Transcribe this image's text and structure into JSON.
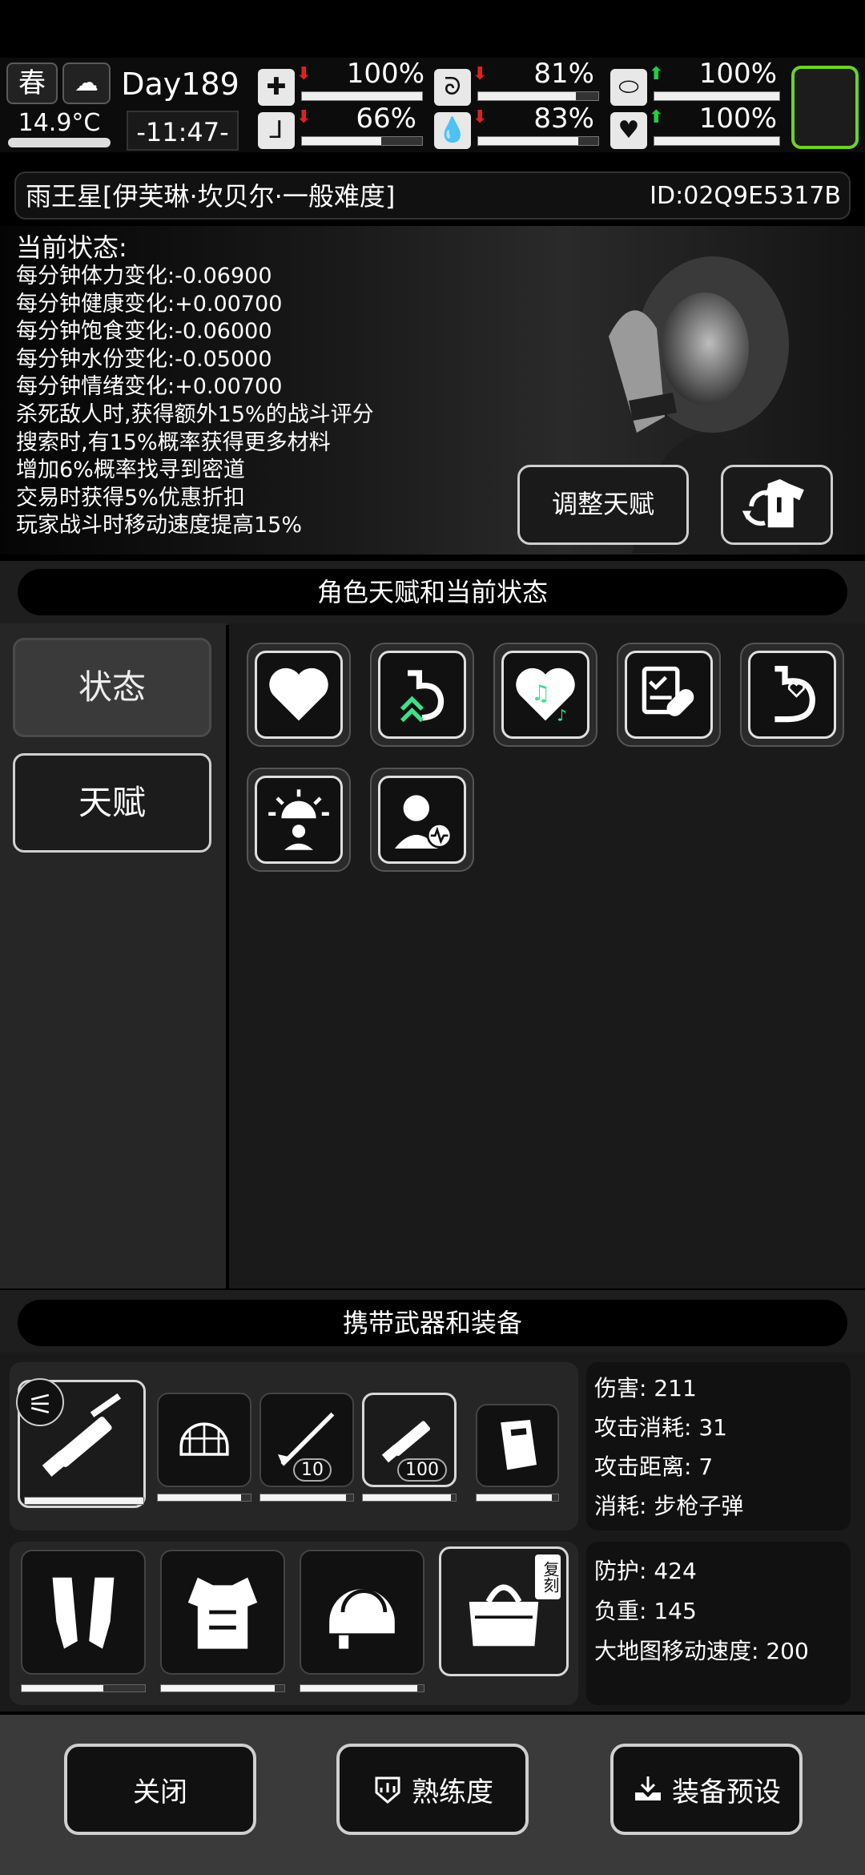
{
  "topbar": {
    "season": "春",
    "temperature": "14.9°C",
    "day": "Day189",
    "time": "-11:47-",
    "stats": [
      {
        "name": "health",
        "icon": "medkit-icon",
        "trend": "down",
        "value": "100%",
        "level": 1.0
      },
      {
        "name": "food",
        "icon": "stomach-icon",
        "trend": "down",
        "value": "81%",
        "level": 0.81
      },
      {
        "name": "stamina",
        "icon": "pill-icon",
        "trend": "up",
        "value": "100%",
        "level": 1.0
      },
      {
        "name": "leg",
        "icon": "leg-icon",
        "trend": "down",
        "value": "66%",
        "level": 0.66
      },
      {
        "name": "water",
        "icon": "water-drop-icon",
        "trend": "down",
        "value": "83%",
        "level": 0.83
      },
      {
        "name": "mood",
        "icon": "heart-icon",
        "trend": "up",
        "value": "100%",
        "level": 1.0
      }
    ]
  },
  "character": {
    "name": "雨王星[伊芙琳·坎贝尔·一般难度]",
    "id": "ID:02Q9E5317B"
  },
  "status": {
    "heading": "当前状态:",
    "lines": [
      "每分钟体力变化:-0.06900",
      "每分钟健康变化:+0.00700",
      "每分钟饱食变化:-0.06000",
      "每分钟水份变化:-0.05000",
      "每分钟情绪变化:+0.00700",
      "杀死敌人时,获得额外15%的战斗评分",
      "搜索时,有15%概率获得更多材料",
      "增加6%概率找寻到密道",
      "交易时获得5%优惠折扣",
      "玩家战斗时移动速度提高15%"
    ],
    "adjust_talent_label": "调整天赋"
  },
  "talents_section": {
    "title": "角色天赋和当前状态",
    "tabs": [
      "状态",
      "天赋"
    ]
  },
  "equipment_section": {
    "title": "携带武器和装备",
    "weapon_counts": [
      "10",
      "100"
    ],
    "weapon_durability": [
      1.0,
      0.9,
      0.92,
      0.95,
      0.92
    ],
    "armor_durability": [
      0.66,
      0.92,
      0.95
    ],
    "weapon_stats": [
      "伤害: 211",
      "攻击消耗: 31",
      "攻击距离: 7",
      "消耗: 步枪子弹"
    ],
    "armor_stats": [
      "防护: 424",
      "负重: 145",
      "大地图移动速度: 200"
    ],
    "bag_tag": "复刻"
  },
  "footer": {
    "close": "关闭",
    "proficiency": "熟练度",
    "preset": "装备预设"
  }
}
